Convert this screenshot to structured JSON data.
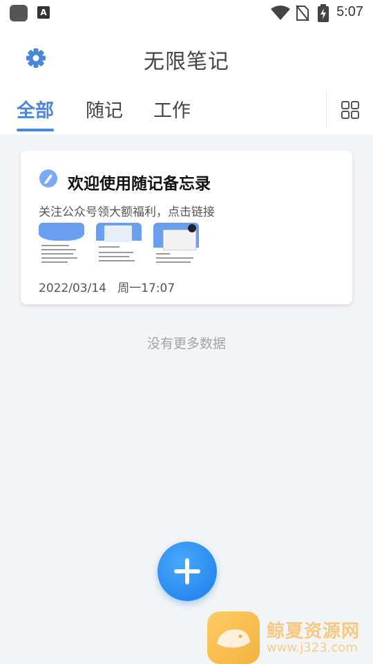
{
  "status_bar": {
    "time": "5:07",
    "font_badge": "A",
    "icons": [
      "app-icon",
      "font-icon",
      "wifi-icon",
      "no-sim-icon",
      "battery-charging-icon"
    ]
  },
  "header": {
    "title": "无限笔记",
    "settings_icon": "gear-icon",
    "accent_color": "#4a86d9"
  },
  "tabs": [
    {
      "label": "全部",
      "active": true
    },
    {
      "label": "随记",
      "active": false
    },
    {
      "label": "工作",
      "active": false
    }
  ],
  "grid_icon": "grid-view-icon",
  "notes": [
    {
      "icon": "pen-icon",
      "title": "欢迎使用随记备忘录",
      "description": "关注公众号领大额福利，点击链接",
      "thumbnails": 3,
      "date": "2022/03/14",
      "weekday_time": "周一17:07"
    }
  ],
  "empty_hint": "没有更多数据",
  "fab": {
    "icon": "plus-icon",
    "color": "#2b8df0"
  },
  "watermark": {
    "name": "鲸夏资源网",
    "url": "www.j323.com"
  }
}
